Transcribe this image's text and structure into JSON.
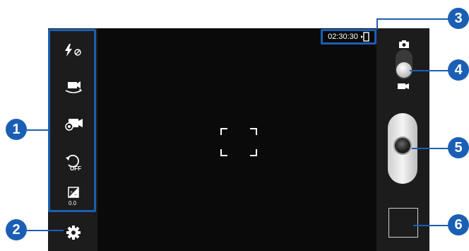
{
  "status": {
    "recording_time": "02:30:30"
  },
  "menu": {
    "items": [
      {
        "name": "flash-off",
        "label": ""
      },
      {
        "name": "switch-camera",
        "label": ""
      },
      {
        "name": "shooting-mode",
        "label": ""
      },
      {
        "name": "timer-off",
        "label": "OFF"
      },
      {
        "name": "exposure",
        "label": "0.0"
      }
    ]
  },
  "callouts": [
    "1",
    "2",
    "3",
    "4",
    "5",
    "6"
  ],
  "colors": {
    "accent": "#1a5fb4",
    "screen": "#0a0a0a",
    "panel": "#1c1c1c"
  },
  "icons": [
    "flash-off-icon",
    "switch-camera-icon",
    "shooting-mode-icon",
    "timer-off-icon",
    "exposure-icon",
    "settings-gear-icon",
    "storage-icon",
    "camera-mode-icon",
    "video-mode-icon"
  ]
}
